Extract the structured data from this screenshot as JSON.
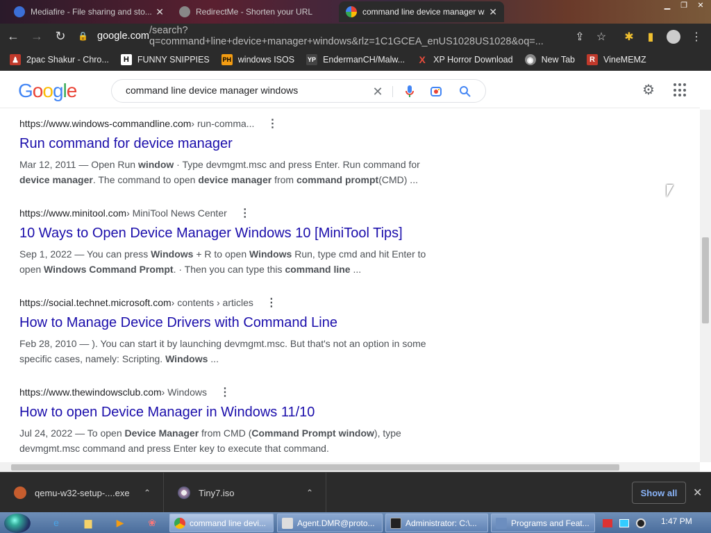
{
  "browser": {
    "tabs": [
      {
        "label": "Mediafire - File sharing and sto..."
      },
      {
        "label": "RedirectMe - Shorten your URL"
      },
      {
        "label": "command line device manager w..."
      }
    ],
    "address": {
      "domain": "google.com",
      "path": "/search?q=command+line+device+manager+windows&rlz=1C1GCEA_enUS1028US1028&oq=..."
    },
    "bookmarks": [
      {
        "label": "2pac Shakur - Chro...",
        "color": "#c0392b",
        "glyph": "♟"
      },
      {
        "label": "FUNNY SNIPPIES",
        "color": "#ffffff",
        "glyph": "H"
      },
      {
        "label": "windows ISOS",
        "color": "#f39c12",
        "glyph": "PH"
      },
      {
        "label": "EndermanCH/Malw...",
        "color": "#444444",
        "glyph": "YP"
      },
      {
        "label": "XP Horror Download",
        "color": "#e74c3c",
        "glyph": "X"
      },
      {
        "label": "New Tab",
        "color": "#888888",
        "glyph": "◉"
      },
      {
        "label": "VineMEMZ",
        "color": "#c0392b",
        "glyph": "R"
      }
    ]
  },
  "google": {
    "logo": "Google",
    "query": "command line device manager windows"
  },
  "results": [
    {
      "url": "https://www.windows-commandline.com",
      "crumb": " › run-comma...",
      "title": "Run command for device manager",
      "snippet_html": "Mar 12, 2011 — Open Run <b>window</b> · Type devmgmt.msc and press Enter. Run command for <b>device manager</b>. The command to open <b>device manager</b> from <b>command prompt</b>(CMD) ..."
    },
    {
      "url": "https://www.minitool.com",
      "crumb": " › MiniTool News Center",
      "title": "10 Ways to Open Device Manager Windows 10 [MiniTool Tips]",
      "snippet_html": "Sep 1, 2022 — You can press <b>Windows</b> + R to open <b>Windows</b> Run, type cmd and hit Enter to open <b>Windows Command Prompt</b>. · Then you can type this <b>command line</b> ..."
    },
    {
      "url": "https://social.technet.microsoft.com",
      "crumb": " › contents › articles",
      "title": "How to Manage Device Drivers with Command Line",
      "snippet_html": "Feb 28, 2010 — ). You can start it by launching devmgmt.msc. But that's not an option in some specific cases, namely: Scripting. <b>Windows</b> ..."
    },
    {
      "url": "https://www.thewindowsclub.com",
      "crumb": " › Windows",
      "title": "How to open Device Manager in Windows 11/10",
      "snippet_html": "Jul 24, 2022 — To open <b>Device Manager</b> from CMD (<b>Command Prompt window</b>), type devmgmt.msc command and press Enter key to execute that command."
    }
  ],
  "downloads": {
    "items": [
      {
        "name": "qemu-w32-setup-....exe"
      },
      {
        "name": "Tiny7.iso"
      }
    ],
    "show_all": "Show all"
  },
  "taskbar": {
    "tasks": [
      {
        "label": "command line devi...",
        "color": "#4285f4"
      },
      {
        "label": "Agent.DMR@proto...",
        "color": "#dddddd"
      },
      {
        "label": "Administrator: C:\\...",
        "color": "#222222"
      },
      {
        "label": "Programs and Feat...",
        "color": "#6c8ebf"
      }
    ],
    "clock": "1:47 PM"
  }
}
